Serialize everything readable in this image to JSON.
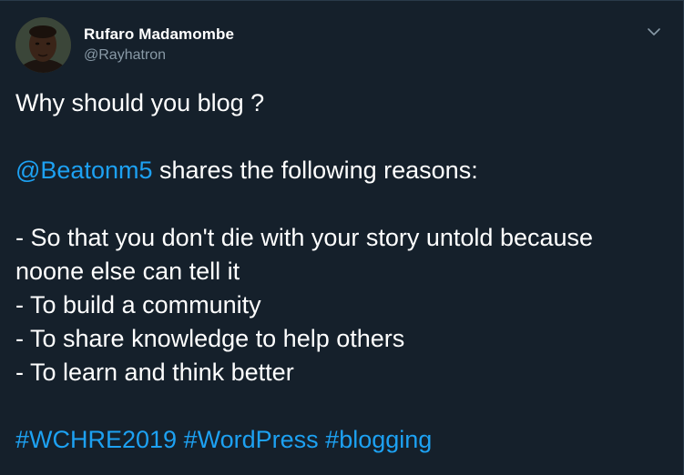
{
  "author": {
    "name": "Rufaro Madamombe",
    "handle": "@Rayhatron"
  },
  "icons": {
    "avatar": "avatar-photo",
    "caret": "chevron-down-icon"
  },
  "colors": {
    "background": "#15202b",
    "text": "#ffffff",
    "secondary_text": "#8899a6",
    "link": "#1da1f2"
  },
  "tweet": {
    "line1": "Why should you blog ?",
    "mention": "@Beatonm5",
    "mention_rest": " shares the following reasons:",
    "reasons": [
      "- So that you don't die with your story untold because noone else can tell it",
      "- To build a community",
      "- To share knowledge to help others",
      "- To learn and think better"
    ],
    "hashtags": [
      "#WCHRE2019",
      "#WordPress",
      "#blogging"
    ]
  }
}
